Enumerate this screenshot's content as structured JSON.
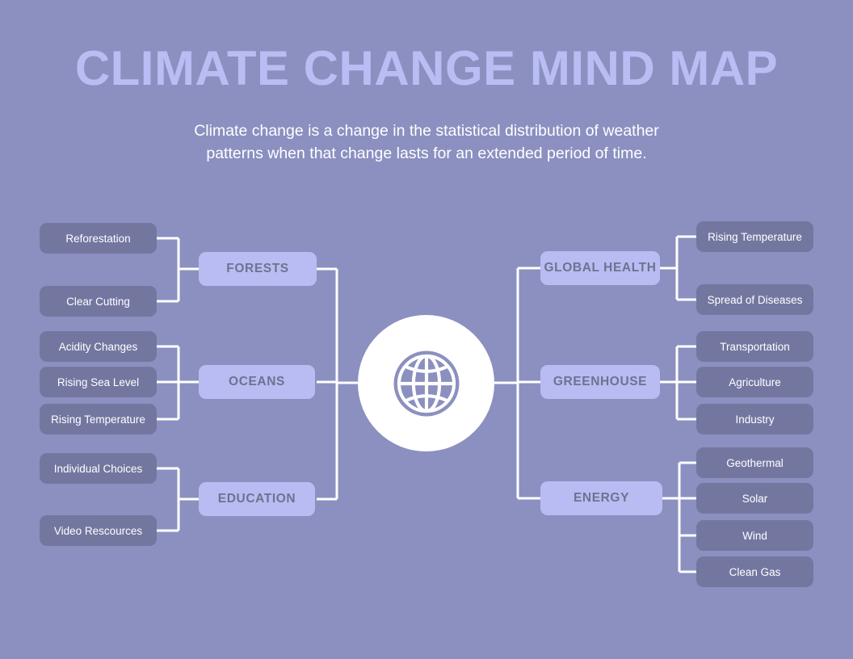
{
  "header": {
    "title": "CLIMATE CHANGE MIND MAP",
    "subtitle": "Climate change is a change in the statistical distribution of weather patterns when that change lasts for an extended period of time."
  },
  "center": {
    "icon": "globe-icon"
  },
  "colors": {
    "background": "#8b90c0",
    "leaf_node": "#7377a0",
    "category_node": "#b8bcf2",
    "title": "#b9bdf3",
    "connector": "#ffffff",
    "hub_disc": "#ffffff",
    "globe_fill": "#8b90c0"
  },
  "branches": {
    "left": [
      {
        "category": "FORESTS",
        "children": [
          "Reforestation",
          "Clear Cutting"
        ]
      },
      {
        "category": "OCEANS",
        "children": [
          "Acidity Changes",
          "Rising Sea Level",
          "Rising Temperature"
        ]
      },
      {
        "category": "EDUCATION",
        "children": [
          "Individual Choices",
          "Video Rescources"
        ]
      }
    ],
    "right": [
      {
        "category": "GLOBAL HEALTH",
        "children": [
          "Rising Temperature",
          "Spread of Diseases"
        ]
      },
      {
        "category": "GREENHOUSE",
        "children": [
          "Transportation",
          "Agriculture",
          "Industry"
        ]
      },
      {
        "category": "ENERGY",
        "children": [
          "Geothermal",
          "Solar",
          "Wind",
          "Clean Gas"
        ]
      }
    ]
  }
}
